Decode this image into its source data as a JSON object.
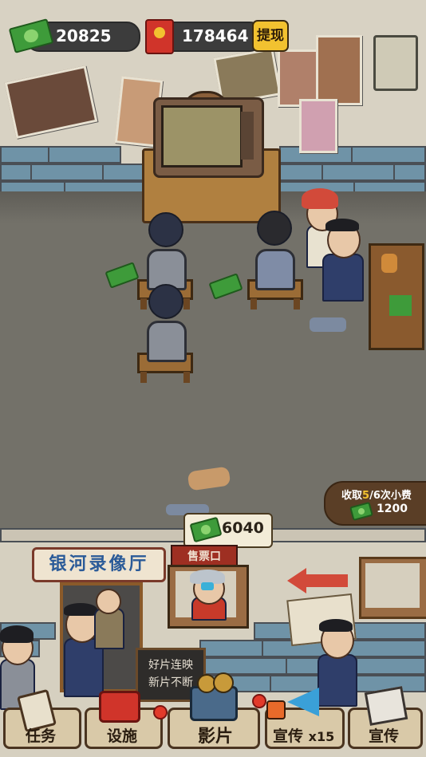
{
  "hud": {
    "cash_value": "20825",
    "redpacket_value": "178464",
    "withdraw_label": "提现"
  },
  "shop": {
    "sign": "银河录像厅",
    "ticket_label": "售票口",
    "menu_line1": "好片连映",
    "menu_line2": "新片不断"
  },
  "tips": {
    "title_prefix": "收取",
    "collected": "5",
    "separator": "/",
    "total": "6",
    "title_suffix": "次小费",
    "amount": "1200"
  },
  "earnings": {
    "amount": "6040"
  },
  "bottom_nav": [
    {
      "label": "任务",
      "icon": "clipboard-icon"
    },
    {
      "label": "设施",
      "icon": "basket-icon"
    },
    {
      "label": "影片",
      "icon": "film-projector-icon"
    },
    {
      "label": "宣传",
      "suffix": "x15",
      "icon": "megaphone-icon"
    },
    {
      "label": "宣传",
      "icon": "newspaper-icon"
    }
  ],
  "colors": {
    "wall": "#d8d2c3",
    "brick": "#6f93a7",
    "floor": "#737169",
    "gold": "#f2c230",
    "cash_green": "#3e9b3a"
  }
}
